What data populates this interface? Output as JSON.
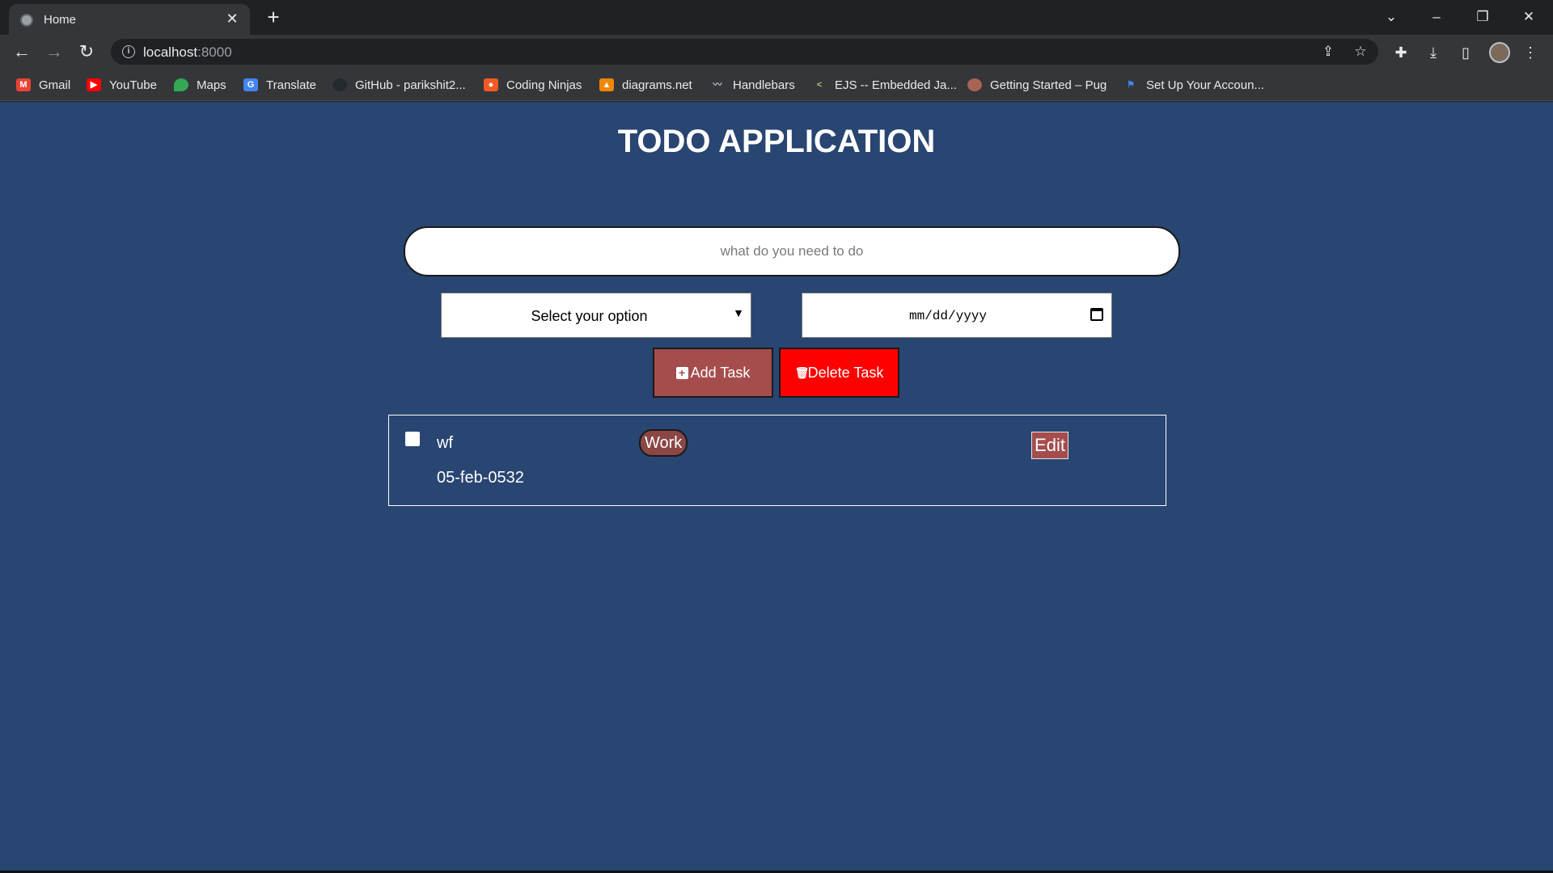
{
  "browser": {
    "tab_title": "Home",
    "url_host": "localhost",
    "url_port": ":8000",
    "bookmarks": [
      {
        "label": "Gmail",
        "icon": "gmail-icon",
        "color": "#ea4335"
      },
      {
        "label": "YouTube",
        "icon": "youtube-icon",
        "color": "#ff0000"
      },
      {
        "label": "Maps",
        "icon": "maps-icon",
        "color": "#34a853"
      },
      {
        "label": "Translate",
        "icon": "translate-icon",
        "color": "#4285f4"
      },
      {
        "label": "GitHub - parikshit2...",
        "icon": "github-icon",
        "color": "#24292e"
      },
      {
        "label": "Coding Ninjas",
        "icon": "coding-ninjas-icon",
        "color": "#f15a24"
      },
      {
        "label": "diagrams.net",
        "icon": "diagrams-icon",
        "color": "#f08705"
      },
      {
        "label": "Handlebars",
        "icon": "handlebars-icon",
        "color": "#9aa0a6"
      },
      {
        "label": "EJS -- Embedded Ja...",
        "icon": "ejs-icon",
        "color": "#b4ca65"
      },
      {
        "label": "Getting Started – Pug",
        "icon": "pug-icon",
        "color": "#a86454"
      },
      {
        "label": "Set Up Your Accoun...",
        "icon": "flag-icon",
        "color": "#4285f4"
      }
    ]
  },
  "app": {
    "title": "TODO APPLICATION",
    "input_placeholder": "what do you need to do",
    "category_select": "Select your option",
    "date_placeholder": "mm/dd/yyyy",
    "add_label": "Add Task",
    "delete_label": "Delete Task",
    "tasks": [
      {
        "name": "wf",
        "date": "05-feb-0532",
        "category": "Work",
        "edit_label": "Edit",
        "done": false
      }
    ]
  },
  "colors": {
    "page_bg": "#294571",
    "add_button": "#a54d4d",
    "delete_button": "#fd0000",
    "category_badge": "#8b4646"
  }
}
